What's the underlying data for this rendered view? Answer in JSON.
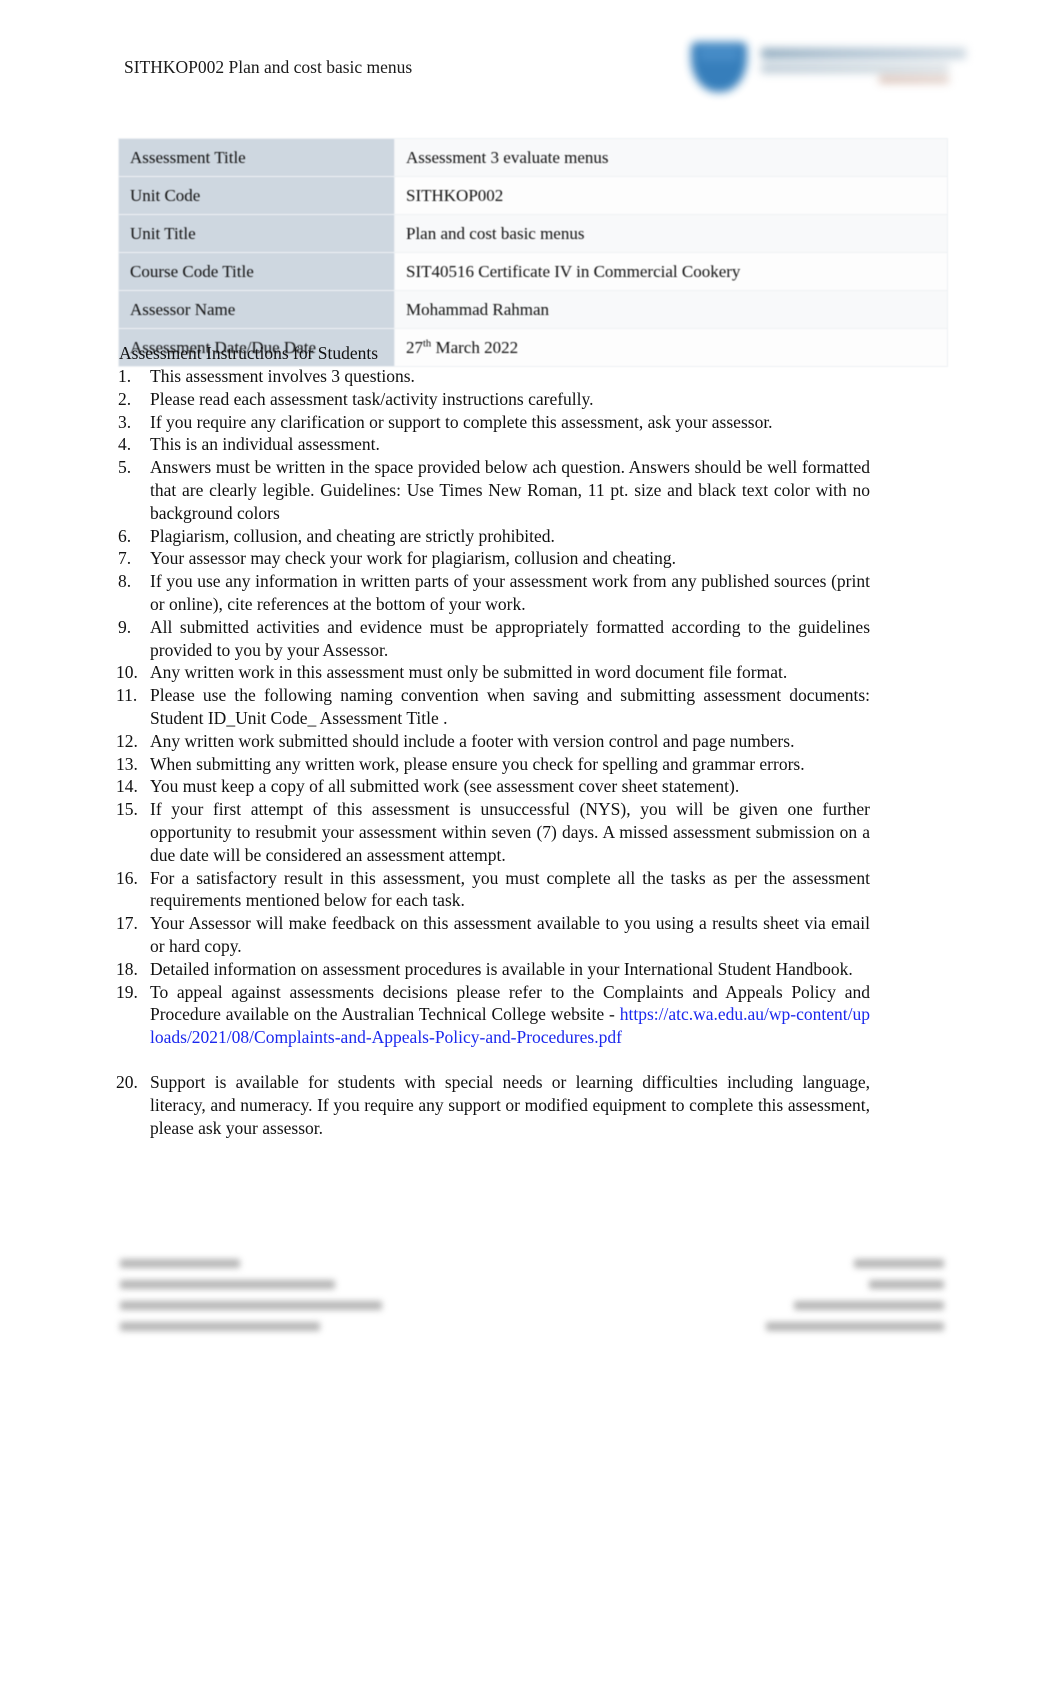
{
  "header": {
    "document_title": "SITHKOP002 Plan and cost basic menus",
    "logo_name": "australian-technical-college-logo",
    "logo_color": "#2c78b8"
  },
  "info_table": {
    "rows": [
      {
        "label": "Assessment Title",
        "value": "Assessment 3 evaluate menus"
      },
      {
        "label": "Unit Code",
        "value": "SITHKOP002"
      },
      {
        "label": "Unit Title",
        "value": "Plan and cost basic menus"
      },
      {
        "label": "Course Code Title",
        "value": "SIT40516 Certificate IV in Commercial Cookery"
      },
      {
        "label": "Assessor Name",
        "value": "Mohammad Rahman"
      },
      {
        "label": "Assessment Date/Due Date",
        "value_prefix": "27",
        "value_sup": "th",
        "value_suffix": " March 2022"
      }
    ]
  },
  "instructions": {
    "heading": "Assessment Instructions for Students",
    "items": [
      {
        "num": "1.",
        "text": "This assessment involves 3 questions."
      },
      {
        "num": "2.",
        "text": "Please read each assessment task/activity instructions carefully."
      },
      {
        "num": "3.",
        "text": "If you require any clarification or support to complete this assessment, ask your assessor."
      },
      {
        "num": "4.",
        "text": "This is an individual assessment."
      },
      {
        "num": "5.",
        "text": "Answers must be written in the space provided below ach question. Answers should be well formatted that are clearly legible. Guidelines: Use Times New Roman, 11 pt. size and black text color with no background colors"
      },
      {
        "num": "6.",
        "text": "Plagiarism, collusion, and cheating are strictly prohibited."
      },
      {
        "num": "7.",
        "text": "Your assessor may check your work for plagiarism, collusion and cheating."
      },
      {
        "num": "8.",
        "text": "If you use any information in written parts of your assessment work from any published sources (print or online), cite references at the bottom of your work."
      },
      {
        "num": "9.",
        "text": "All submitted activities and evidence must be appropriately formatted according to the guidelines provided to you by your Assessor."
      },
      {
        "num": "10.",
        "text": "Any written work in this assessment must only be submitted in word document file format."
      },
      {
        "num": "11.",
        "text": "Please use the following naming convention when saving and submitting assessment documents: Student ID_Unit Code_ Assessment Title   ."
      },
      {
        "num": "12.",
        "text": "Any written work submitted should include a footer with version control and page numbers."
      },
      {
        "num": "13.",
        "text": "When submitting any written work, please ensure you check for spelling and grammar errors."
      },
      {
        "num": "14.",
        "text": "You must keep a copy of all submitted work (see assessment cover sheet statement)."
      },
      {
        "num": "15.",
        "text": "If your first attempt of this assessment is unsuccessful (NYS), you will be given one further opportunity to resubmit your assessment within seven (7) days. A missed assessment submission on a due date will be considered an assessment attempt."
      },
      {
        "num": "16.",
        "text": "For a satisfactory result in this assessment, you must complete all the tasks as per the assessment requirements mentioned below for each task."
      },
      {
        "num": "17.",
        "text": "Your Assessor will make feedback on this assessment available to you using a results sheet via email or hard copy."
      },
      {
        "num": "18.",
        "text": "Detailed information on assessment procedures is available in your International Student Handbook."
      },
      {
        "num": "19.",
        "text_before_link": "To appeal against assessments decisions please refer to the Complaints and Appeals Policy  and  Procedure  available  on  the  Australian  Technical  College  website  - ",
        "link_text": "https://atc.wa.edu.au/wp-content/uploads/2021/08/Complaints-and-Appeals-Policy-and-Procedures.pdf",
        "link_color": "#1a27ee"
      },
      {
        "num": "20.",
        "text": "Support is available for students with special needs or learning difficulties including language, literacy, and numeracy. If you require any support or modified equipment to complete this assessment, please ask your assessor."
      }
    ]
  }
}
